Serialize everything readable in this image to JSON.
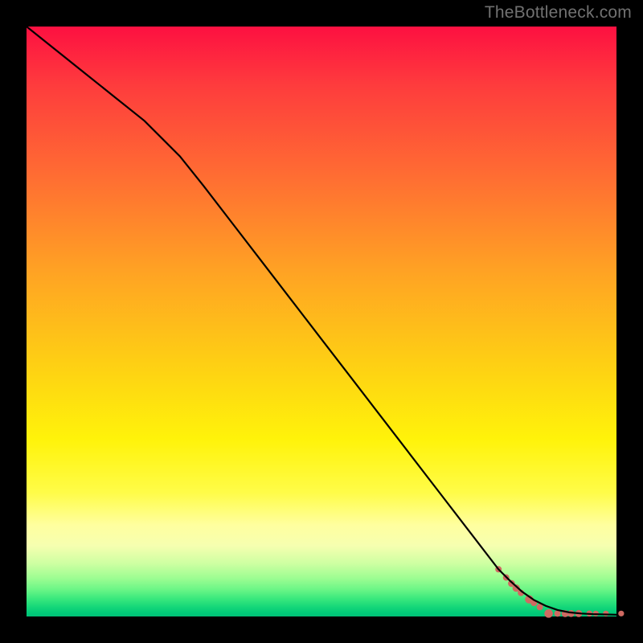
{
  "watermark": "TheBottleneck.com",
  "chart_data": {
    "type": "line",
    "title": "",
    "xlabel": "",
    "ylabel": "",
    "xlim": [
      0,
      100
    ],
    "ylim": [
      0,
      100
    ],
    "series": [
      {
        "name": "curve",
        "style": "line",
        "color": "#000000",
        "x": [
          0,
          5,
          10,
          15,
          20,
          23,
          26,
          30,
          35,
          40,
          45,
          50,
          55,
          60,
          65,
          70,
          75,
          80,
          82,
          84,
          86,
          88,
          90,
          92,
          94,
          96,
          98,
          100
        ],
        "y": [
          100,
          96,
          92,
          88,
          84,
          81,
          78,
          73,
          66.5,
          60,
          53.5,
          47,
          40.5,
          34,
          27.5,
          21,
          14.5,
          8,
          6,
          4.2,
          2.8,
          1.8,
          1.1,
          0.7,
          0.5,
          0.4,
          0.35,
          0.3
        ]
      },
      {
        "name": "dots",
        "style": "scatter",
        "color": "#cf6a62",
        "points": [
          {
            "x": 80.0,
            "y": 8.0,
            "r": 4.0
          },
          {
            "x": 81.3,
            "y": 6.6,
            "r": 4.0
          },
          {
            "x": 82.2,
            "y": 5.6,
            "r": 4.3
          },
          {
            "x": 83.0,
            "y": 4.8,
            "r": 4.6
          },
          {
            "x": 83.8,
            "y": 4.0,
            "r": 4.0
          },
          {
            "x": 85.2,
            "y": 2.9,
            "r": 5.2
          },
          {
            "x": 86.0,
            "y": 2.3,
            "r": 4.0
          },
          {
            "x": 87.0,
            "y": 1.6,
            "r": 4.0
          },
          {
            "x": 88.5,
            "y": 0.5,
            "r": 5.3
          },
          {
            "x": 90.0,
            "y": 0.5,
            "r": 4.0
          },
          {
            "x": 91.3,
            "y": 0.5,
            "r": 4.4
          },
          {
            "x": 92.3,
            "y": 0.5,
            "r": 4.3
          },
          {
            "x": 93.6,
            "y": 0.5,
            "r": 4.4
          },
          {
            "x": 95.4,
            "y": 0.5,
            "r": 3.8
          },
          {
            "x": 96.5,
            "y": 0.5,
            "r": 3.6
          },
          {
            "x": 98.2,
            "y": 0.5,
            "r": 3.6
          },
          {
            "x": 100.8,
            "y": 0.5,
            "r": 3.6
          }
        ]
      }
    ]
  }
}
